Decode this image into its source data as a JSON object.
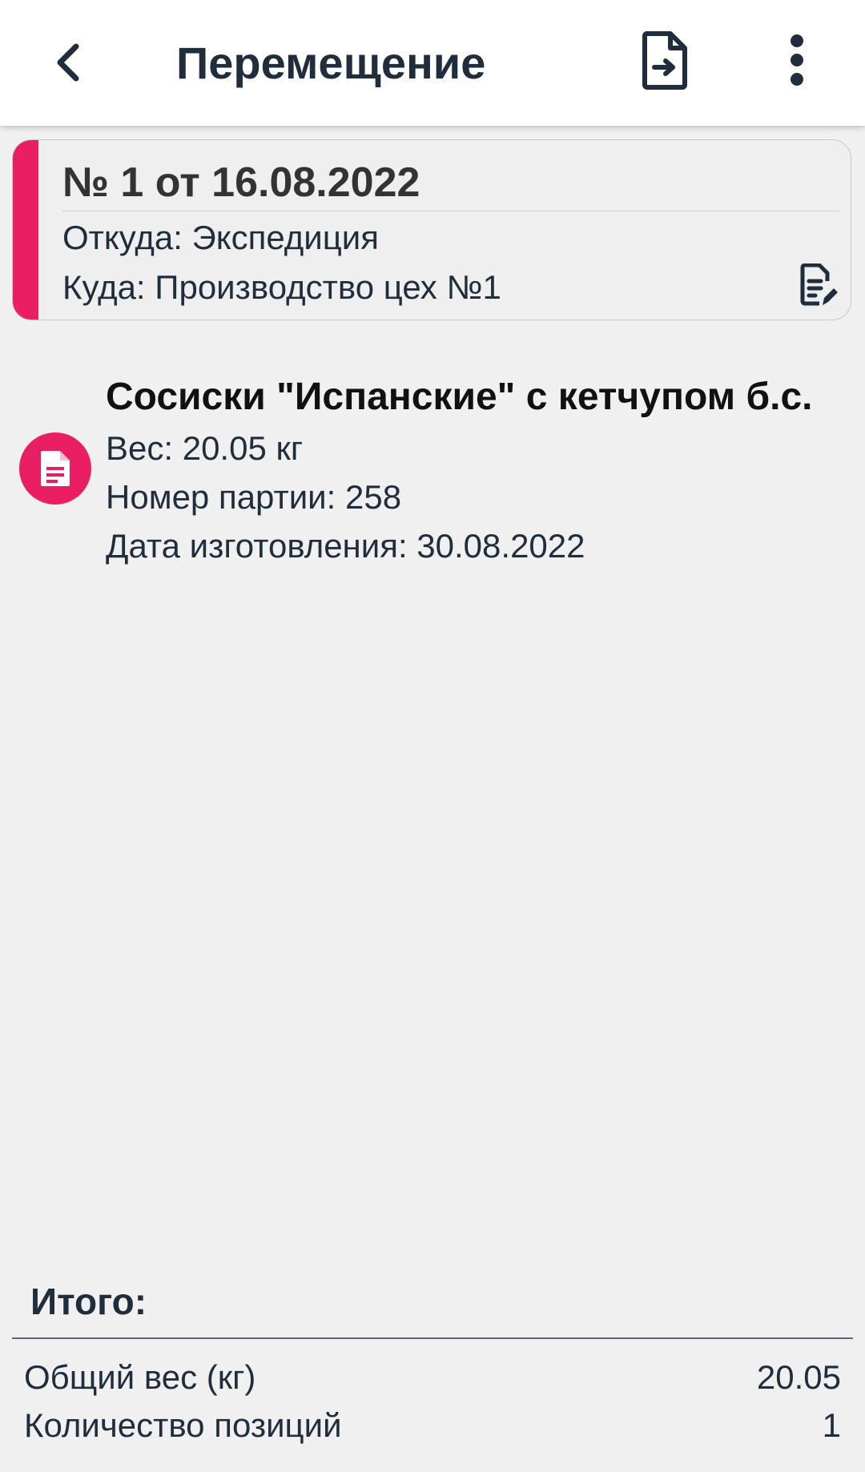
{
  "app_bar": {
    "title": "Перемещение",
    "icons": {
      "back": "chevron-left-icon",
      "export": "file-export-icon",
      "more": "more-vertical-icon"
    }
  },
  "document": {
    "title": "№ 1 от 16.08.2022",
    "from": "Откуда: Экспедиция",
    "to": "Куда: Производство цех №1",
    "accent_color": "#e91e63",
    "edit_icon": "document-edit-icon"
  },
  "items": [
    {
      "name": "Сосиски \"Испанские\" с кетчупом б.с.",
      "weight": "Вес: 20.05 кг",
      "batch": "Номер партии: 258",
      "production_date": "Дата изготовления: 30.08.2022",
      "icon": "document-icon",
      "icon_color": "#e91e63"
    }
  ],
  "totals": {
    "title": "Итого:",
    "total_weight_label": "Общий вес (кг)",
    "total_weight_value": "20.05",
    "positions_label": "Количество позиций",
    "positions_value": "1"
  }
}
